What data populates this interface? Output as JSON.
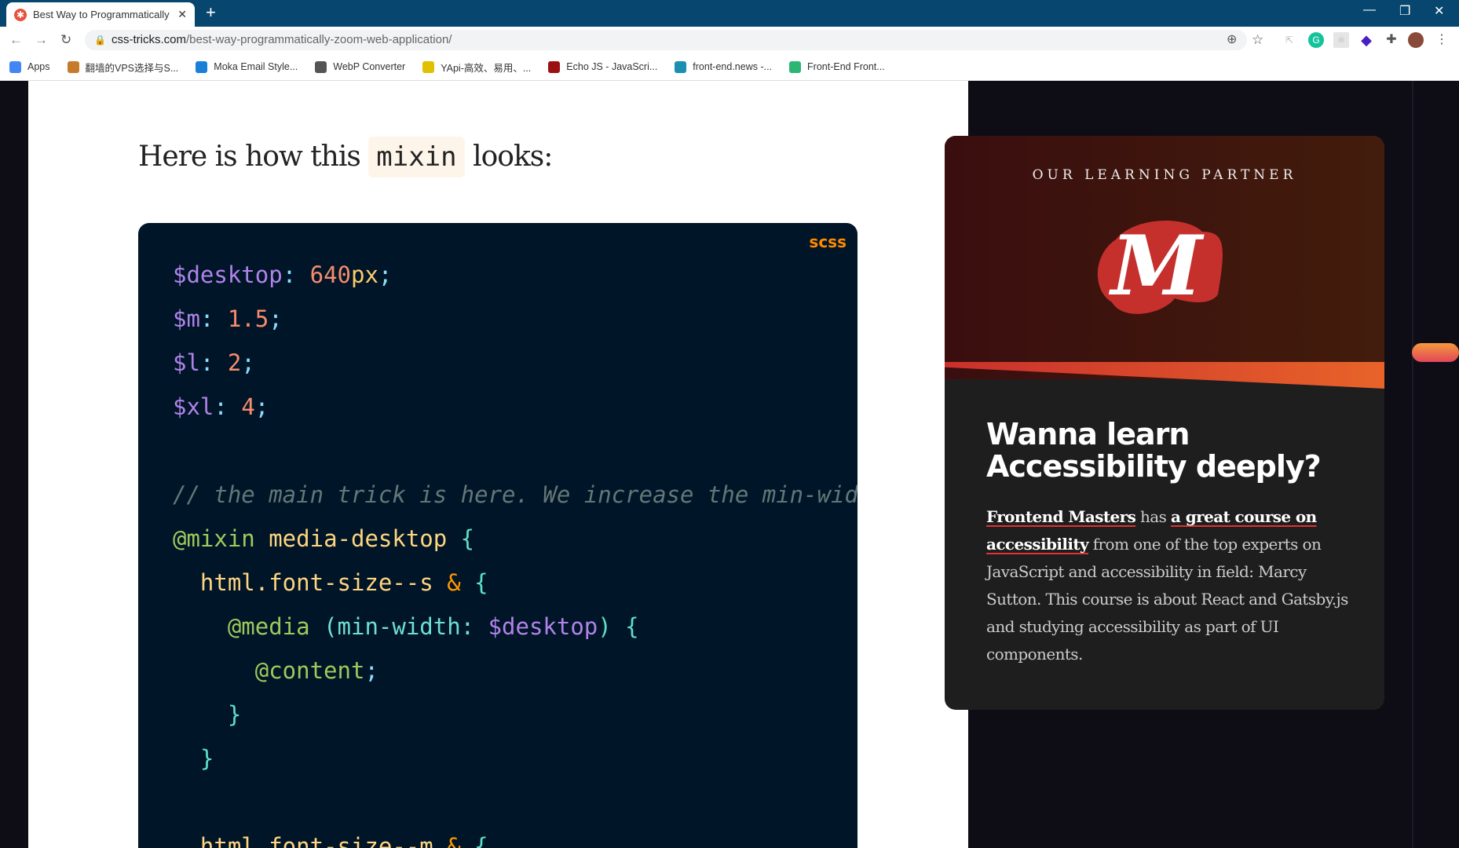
{
  "browser": {
    "tab_title": "Best Way to Programmatically",
    "tab_favicon": "css-tricks-star-icon",
    "url_host": "css-tricks.com",
    "url_path": "/best-way-programmatically-zoom-web-application/",
    "bookmarks": [
      {
        "label": "Apps",
        "icon": "apps-grid-icon",
        "color": "#4285f4"
      },
      {
        "label": "翻墙的VPS选择与S...",
        "icon": "bookmark-avatar-icon",
        "color": "#c77b2a"
      },
      {
        "label": "Moka Email Style...",
        "icon": "mail-icon",
        "color": "#1a7fd6"
      },
      {
        "label": "WebP Converter",
        "icon": "globe-icon",
        "color": "#555555"
      },
      {
        "label": "YApi-高效、易用、...",
        "icon": "yapi-icon",
        "color": "#e0c000"
      },
      {
        "label": "Echo JS - JavaScri...",
        "icon": "js-icon",
        "color": "#9b1111"
      },
      {
        "label": "front-end.news -...",
        "icon": "news-icon",
        "color": "#1a8fb0"
      },
      {
        "label": "Front-End Front...",
        "icon": "frontfront-icon",
        "color": "#2bb673"
      }
    ]
  },
  "article": {
    "lead_before": "Here is how this ",
    "lead_code": "mixin",
    "lead_after": " looks:",
    "code_lang": "scss",
    "code_lines": [
      [
        [
          "$desktop",
          "v"
        ],
        [
          ": ",
          "p"
        ],
        [
          "640",
          "n"
        ],
        [
          "px",
          "u"
        ],
        [
          ";",
          "p"
        ]
      ],
      [
        [
          "$m",
          "v"
        ],
        [
          ": ",
          "p"
        ],
        [
          "1.5",
          "n"
        ],
        [
          ";",
          "p"
        ]
      ],
      [
        [
          "$l",
          "v"
        ],
        [
          ": ",
          "p"
        ],
        [
          "2",
          "n"
        ],
        [
          ";",
          "p"
        ]
      ],
      [
        [
          "$xl",
          "v"
        ],
        [
          ": ",
          "p"
        ],
        [
          "4",
          "n"
        ],
        [
          ";",
          "p"
        ]
      ],
      [],
      [
        [
          "// the main trick is here. We increase the min-width if the user changed the font-size",
          "c"
        ]
      ],
      [
        [
          "@mixin",
          "at"
        ],
        [
          " media-desktop ",
          "s"
        ],
        [
          "{",
          "b"
        ]
      ],
      [
        [
          "  html.font-size--s ",
          "s"
        ],
        [
          "&",
          "amp"
        ],
        [
          " {",
          "b"
        ]
      ],
      [
        [
          "    @media ",
          "at"
        ],
        [
          "(min-width: ",
          "prop"
        ],
        [
          "$desktop",
          "v"
        ],
        [
          ") {",
          "b"
        ]
      ],
      [
        [
          "      @content",
          "at"
        ],
        [
          ";",
          "p"
        ]
      ],
      [
        [
          "    }",
          "b"
        ]
      ],
      [
        [
          "  }",
          "b"
        ]
      ],
      [],
      [
        [
          "  html.font-size--m ",
          "s"
        ],
        [
          "&",
          "amp"
        ],
        [
          " {",
          "b"
        ]
      ]
    ]
  },
  "sidebar": {
    "eyebrow": "OUR LEARNING PARTNER",
    "heading": "Wanna learn Accessibility deeply?",
    "link1": "Frontend Masters",
    "t1": " has ",
    "link2": "a great course on accessibility",
    "t2": " from one of the top experts on JavaScript and accessibility in field: Marcy Sutton. This course is about React and Gatsby.js and studying accessibility as part of UI components.",
    "logo": "frontend-masters-logo",
    "logo_text": "M"
  }
}
